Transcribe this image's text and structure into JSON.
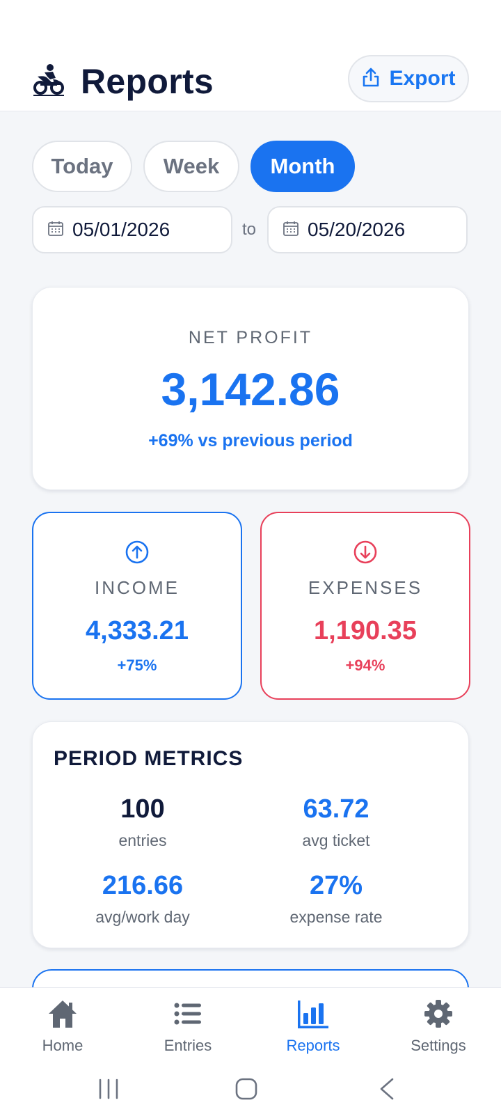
{
  "header": {
    "title": "Reports",
    "export_label": "Export",
    "logo_icon": "motorbike-courier-logo",
    "export_icon": "share-upload-icon"
  },
  "filters": {
    "periods": [
      {
        "label": "Today",
        "active": false
      },
      {
        "label": "Week",
        "active": false
      },
      {
        "label": "Month",
        "active": true
      }
    ],
    "date_from": "05/01/2026",
    "date_to": "05/20/2026",
    "to_label": "to",
    "date_icon": "calendar-icon"
  },
  "net_profit": {
    "label": "NET PROFIT",
    "value": "3,142.86",
    "change": "+69% vs previous period"
  },
  "income": {
    "label": "INCOME",
    "value": "4,333.21",
    "change": "+75%",
    "icon": "arrow-up-circle-icon"
  },
  "expenses": {
    "label": "EXPENSES",
    "value": "1,190.35",
    "change": "+94%",
    "icon": "arrow-down-circle-icon"
  },
  "metrics": {
    "title": "PERIOD METRICS",
    "items": [
      {
        "value": "100",
        "label": "entries"
      },
      {
        "value": "63.72",
        "label": "avg ticket"
      },
      {
        "value": "216.66",
        "label": "avg/work day"
      },
      {
        "value": "27%",
        "label": "expense rate"
      }
    ]
  },
  "nav": {
    "items": [
      {
        "label": "Home",
        "icon": "home-icon",
        "active": false
      },
      {
        "label": "Entries",
        "icon": "list-icon",
        "active": false
      },
      {
        "label": "Reports",
        "icon": "bar-chart-icon",
        "active": true
      },
      {
        "label": "Settings",
        "icon": "gear-icon",
        "active": false
      }
    ]
  },
  "colors": {
    "accent": "#1a73f0",
    "danger": "#e8405a",
    "text_dark": "#101a3a",
    "text_muted": "#5f6773"
  }
}
